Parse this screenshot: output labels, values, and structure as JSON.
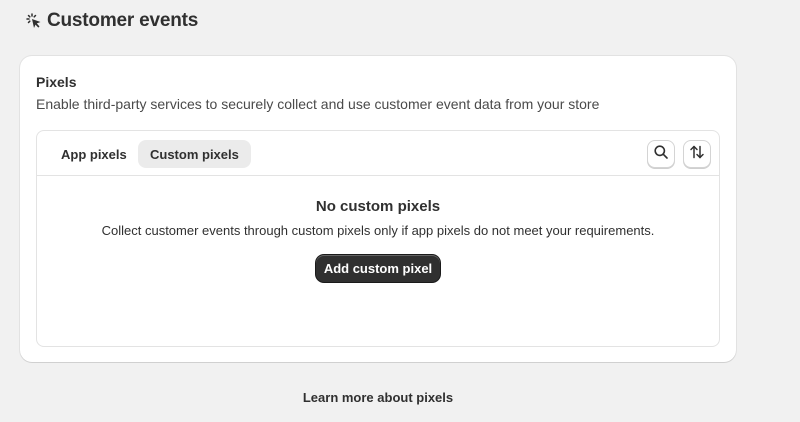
{
  "header": {
    "title": "Customer events",
    "icon": "cursor-click-icon"
  },
  "pixels_card": {
    "title": "Pixels",
    "description": "Enable third-party services to securely collect and use customer event data from your store",
    "tabs": [
      {
        "label": "App pixels",
        "selected": false
      },
      {
        "label": "Custom pixels",
        "selected": true
      }
    ],
    "tools": {
      "search_icon": "search-icon",
      "sort_icon": "sort-icon"
    },
    "empty_state": {
      "title": "No custom pixels",
      "description": "Collect customer events through custom pixels only if app pixels do not meet your requirements.",
      "button_label": "Add custom pixel"
    }
  },
  "footer": {
    "learn_more": "Learn more about pixels"
  },
  "colors": {
    "background": "#f1f1f1",
    "card": "#ffffff",
    "primary_button": "#303030",
    "selected_tab": "#ebebeb"
  }
}
